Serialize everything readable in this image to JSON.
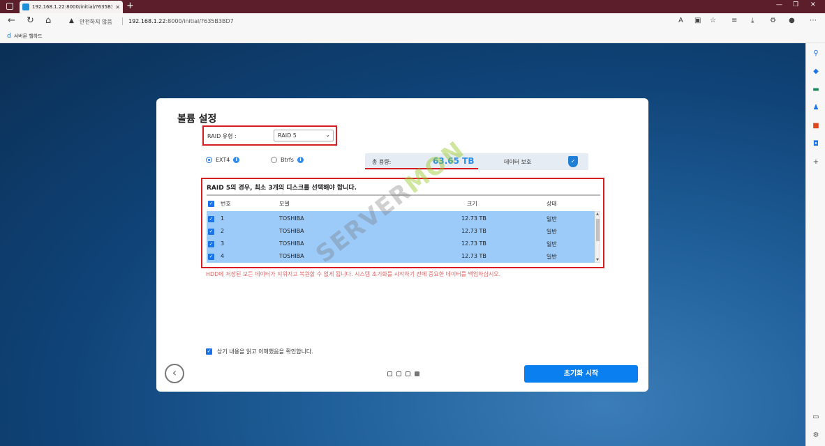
{
  "browser": {
    "tab_title": "192.168.1.22:8000/initial/?635B3",
    "security_label": "안전하지 않음",
    "url_host": "192.168.1.22",
    "url_rest": ":8000/initial/?635B3BD7",
    "bookmark": "서버몬 헬하드"
  },
  "dialog": {
    "title": "볼륨 설정",
    "raid_label": "RAID 유형 :",
    "raid_value": "RAID 5",
    "fs_options": [
      "EXT4",
      "Btrfs"
    ],
    "capacity_label": "총 용량:",
    "capacity_value": "63.65 TB",
    "protection_label": "데이터 보호",
    "disk_message": "RAID 5의 경우, 최소 3개의 디스크를 선택해야 합니다.",
    "columns": [
      "번호",
      "모델",
      "크기",
      "상태"
    ],
    "disks": [
      {
        "no": "1",
        "model": "TOSHIBA",
        "size": "12.73 TB",
        "status": "일반"
      },
      {
        "no": "2",
        "model": "TOSHIBA",
        "size": "12.73 TB",
        "status": "일반"
      },
      {
        "no": "3",
        "model": "TOSHIBA",
        "size": "12.73 TB",
        "status": "일반"
      },
      {
        "no": "4",
        "model": "TOSHIBA",
        "size": "12.73 TB",
        "status": "일반"
      }
    ],
    "warning": "HDD에 저장된 모든 데이터가 지워지고 복원할 수 없게 됩니다. 시스템 초기화를 시작하기 전에 중요한 데이터를 백업하십시오.",
    "confirm_label": "상기 내용을 읽고 이해했음을 확인합니다.",
    "start_label": "초기화 시작"
  },
  "watermark": {
    "text1": "SERVER",
    "text2": "MON"
  },
  "colors": {
    "accent": "#0a7ff0",
    "highlight_box": "#d91b24",
    "selected_row": "#9ccbfa"
  }
}
